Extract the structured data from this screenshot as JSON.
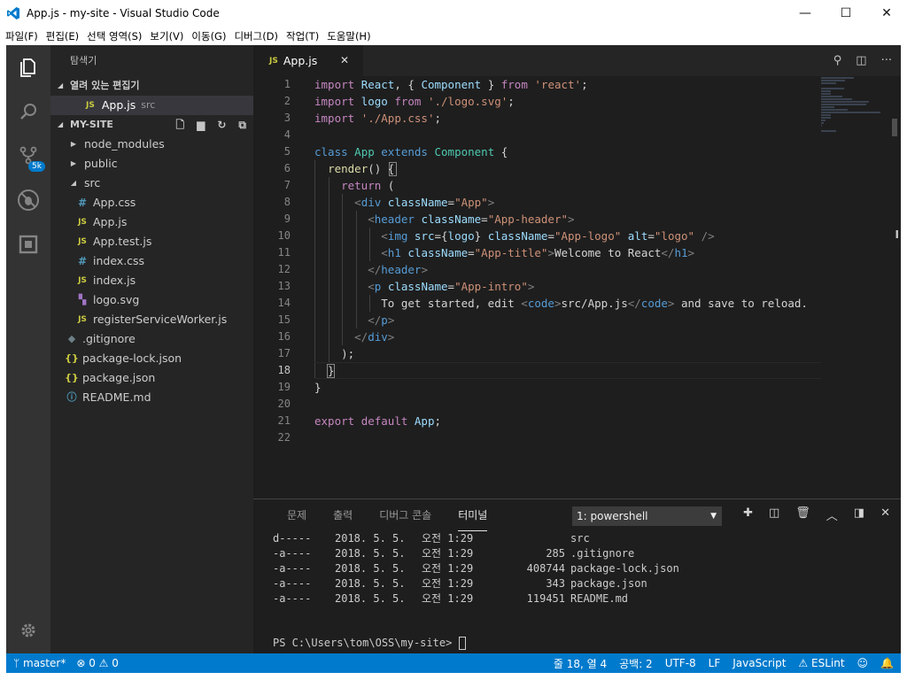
{
  "window": {
    "title": "App.js - my-site - Visual Studio Code",
    "minimize": "—",
    "maximize": "☐",
    "close": "✕"
  },
  "menu": [
    "파일(F)",
    "편집(E)",
    "선택 영역(S)",
    "보기(V)",
    "이동(G)",
    "디버그(D)",
    "작업(T)",
    "도움말(H)"
  ],
  "activity": {
    "scm_badge": "5k"
  },
  "sidebar": {
    "title": "탐색기",
    "open_editors_label": "열려 있는 편집기",
    "open_editor_file": "App.js",
    "open_editor_dir": "src",
    "folder_label": "MY-SITE",
    "tree": [
      {
        "label": "node_modules",
        "icon": "▶",
        "kind": "arrow",
        "indent": 18
      },
      {
        "label": "public",
        "icon": "▶",
        "kind": "arrow",
        "indent": 18
      },
      {
        "label": "src",
        "icon": "◢",
        "kind": "arrow",
        "indent": 18
      },
      {
        "label": "App.css",
        "icon": "#",
        "kind": "css",
        "indent": 28
      },
      {
        "label": "App.js",
        "icon": "JS",
        "kind": "js",
        "indent": 28
      },
      {
        "label": "App.test.js",
        "icon": "JS",
        "kind": "js",
        "indent": 28
      },
      {
        "label": "index.css",
        "icon": "#",
        "kind": "css",
        "indent": 28
      },
      {
        "label": "index.js",
        "icon": "JS",
        "kind": "js",
        "indent": 28
      },
      {
        "label": "logo.svg",
        "icon": "▚",
        "kind": "svg",
        "indent": 28
      },
      {
        "label": "registerServiceWorker.js",
        "icon": "JS",
        "kind": "js",
        "indent": 28
      },
      {
        "label": ".gitignore",
        "icon": "◆",
        "kind": "git",
        "indent": 16
      },
      {
        "label": "package-lock.json",
        "icon": "{}",
        "kind": "json",
        "indent": 16
      },
      {
        "label": "package.json",
        "icon": "{}",
        "kind": "json",
        "indent": 16
      },
      {
        "label": "README.md",
        "icon": "ⓘ",
        "kind": "info",
        "indent": 16
      }
    ]
  },
  "tab": {
    "icon": "JS",
    "label": "App.js",
    "close": "✕"
  },
  "editor": {
    "line_count": 22,
    "lines": [
      [
        [
          "kw",
          "import"
        ],
        [
          "tx",
          " "
        ],
        [
          "va",
          "React"
        ],
        [
          "tx",
          ", { "
        ],
        [
          "va",
          "Component"
        ],
        [
          "tx",
          " } "
        ],
        [
          "kw",
          "from"
        ],
        [
          "tx",
          " "
        ],
        [
          "st",
          "'react'"
        ],
        [
          "tx",
          ";"
        ]
      ],
      [
        [
          "kw",
          "import"
        ],
        [
          "tx",
          " "
        ],
        [
          "va",
          "logo"
        ],
        [
          "tx",
          " "
        ],
        [
          "kw",
          "from"
        ],
        [
          "tx",
          " "
        ],
        [
          "st",
          "'./logo.svg'"
        ],
        [
          "tx",
          ";"
        ]
      ],
      [
        [
          "kw",
          "import"
        ],
        [
          "tx",
          " "
        ],
        [
          "st",
          "'./App.css'"
        ],
        [
          "tx",
          ";"
        ]
      ],
      [],
      [
        [
          "kb",
          "class"
        ],
        [
          "tx",
          " "
        ],
        [
          "ty",
          "App"
        ],
        [
          "tx",
          " "
        ],
        [
          "kb",
          "extends"
        ],
        [
          "tx",
          " "
        ],
        [
          "ty",
          "Component"
        ],
        [
          "tx",
          " {"
        ]
      ],
      [
        [
          "tx",
          "  "
        ],
        [
          "fn",
          "render"
        ],
        [
          "tx",
          "() {"
        ]
      ],
      [
        [
          "tx",
          "    "
        ],
        [
          "kw",
          "return"
        ],
        [
          "tx",
          " ("
        ]
      ],
      [
        [
          "tx",
          "      "
        ],
        [
          "pu",
          "<"
        ],
        [
          "tg",
          "div"
        ],
        [
          "tx",
          " "
        ],
        [
          "at",
          "className"
        ],
        [
          "tx",
          "="
        ],
        [
          "st",
          "\"App\""
        ],
        [
          "pu",
          ">"
        ]
      ],
      [
        [
          "tx",
          "        "
        ],
        [
          "pu",
          "<"
        ],
        [
          "tg",
          "header"
        ],
        [
          "tx",
          " "
        ],
        [
          "at",
          "className"
        ],
        [
          "tx",
          "="
        ],
        [
          "st",
          "\"App-header\""
        ],
        [
          "pu",
          ">"
        ]
      ],
      [
        [
          "tx",
          "          "
        ],
        [
          "pu",
          "<"
        ],
        [
          "tg",
          "img"
        ],
        [
          "tx",
          " "
        ],
        [
          "at",
          "src"
        ],
        [
          "tx",
          "={"
        ],
        [
          "va",
          "logo"
        ],
        [
          "tx",
          "} "
        ],
        [
          "at",
          "className"
        ],
        [
          "tx",
          "="
        ],
        [
          "st",
          "\"App-logo\""
        ],
        [
          "tx",
          " "
        ],
        [
          "at",
          "alt"
        ],
        [
          "tx",
          "="
        ],
        [
          "st",
          "\"logo\""
        ],
        [
          "tx",
          " "
        ],
        [
          "pu",
          "/>"
        ]
      ],
      [
        [
          "tx",
          "          "
        ],
        [
          "pu",
          "<"
        ],
        [
          "tg",
          "h1"
        ],
        [
          "tx",
          " "
        ],
        [
          "at",
          "className"
        ],
        [
          "tx",
          "="
        ],
        [
          "st",
          "\"App-title\""
        ],
        [
          "pu",
          ">"
        ],
        [
          "tx",
          "Welcome to React"
        ],
        [
          "pu",
          "</"
        ],
        [
          "tg",
          "h1"
        ],
        [
          "pu",
          ">"
        ]
      ],
      [
        [
          "tx",
          "        "
        ],
        [
          "pu",
          "</"
        ],
        [
          "tg",
          "header"
        ],
        [
          "pu",
          ">"
        ]
      ],
      [
        [
          "tx",
          "        "
        ],
        [
          "pu",
          "<"
        ],
        [
          "tg",
          "p"
        ],
        [
          "tx",
          " "
        ],
        [
          "at",
          "className"
        ],
        [
          "tx",
          "="
        ],
        [
          "st",
          "\"App-intro\""
        ],
        [
          "pu",
          ">"
        ]
      ],
      [
        [
          "tx",
          "          To get started, edit "
        ],
        [
          "pu",
          "<"
        ],
        [
          "tg",
          "code"
        ],
        [
          "pu",
          ">"
        ],
        [
          "tx",
          "src/App.js"
        ],
        [
          "pu",
          "</"
        ],
        [
          "tg",
          "code"
        ],
        [
          "pu",
          ">"
        ],
        [
          "tx",
          " and save to reload."
        ]
      ],
      [
        [
          "tx",
          "        "
        ],
        [
          "pu",
          "</"
        ],
        [
          "tg",
          "p"
        ],
        [
          "pu",
          ">"
        ]
      ],
      [
        [
          "tx",
          "      "
        ],
        [
          "pu",
          "</"
        ],
        [
          "tg",
          "div"
        ],
        [
          "pu",
          ">"
        ]
      ],
      [
        [
          "tx",
          "    );"
        ]
      ],
      [
        [
          "tx",
          "  }"
        ]
      ],
      [
        [
          "tx",
          "}"
        ]
      ],
      [],
      [
        [
          "kw",
          "export"
        ],
        [
          "tx",
          " "
        ],
        [
          "kw",
          "default"
        ],
        [
          "tx",
          " "
        ],
        [
          "va",
          "App"
        ],
        [
          "tx",
          ";"
        ]
      ],
      []
    ]
  },
  "panel": {
    "tabs": [
      "문제",
      "출력",
      "디버그 콘솔",
      "터미널"
    ],
    "active_tab": 3,
    "terminal_select": "1: powershell",
    "rows": [
      {
        "mode": "d-----",
        "date": "2018. 5. 5.",
        "time": "오전 1:29",
        "size": "",
        "name": "src"
      },
      {
        "mode": "-a----",
        "date": "2018. 5. 5.",
        "time": "오전 1:29",
        "size": "285",
        "name": ".gitignore"
      },
      {
        "mode": "-a----",
        "date": "2018. 5. 5.",
        "time": "오전 1:29",
        "size": "408744",
        "name": "package-lock.json"
      },
      {
        "mode": "-a----",
        "date": "2018. 5. 5.",
        "time": "오전 1:29",
        "size": "343",
        "name": "package.json"
      },
      {
        "mode": "-a----",
        "date": "2018. 5. 5.",
        "time": "오전 1:29",
        "size": "119451",
        "name": "README.md"
      }
    ],
    "prompt": "PS C:\\Users\\tom\\OSS\\my-site> "
  },
  "status": {
    "branch": "master*",
    "errors": "0",
    "warnings": "0",
    "position": "줄 18, 열 4",
    "spaces": "공백: 2",
    "encoding": "UTF-8",
    "eol": "LF",
    "language": "JavaScript",
    "linter": "ESLint"
  },
  "colors": {
    "accent": "#007acc",
    "editor_bg": "#1e1e1e",
    "sidebar_bg": "#252526",
    "activity_bg": "#333333"
  }
}
